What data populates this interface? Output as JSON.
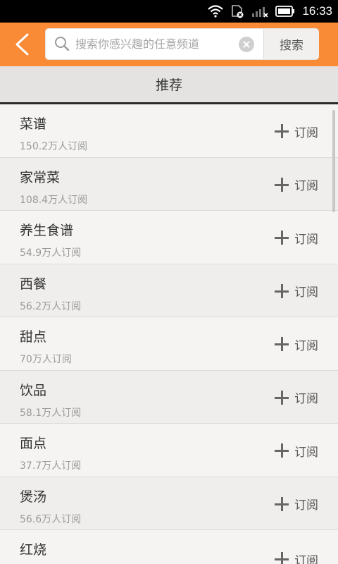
{
  "status_bar": {
    "time": "16:33"
  },
  "header": {
    "search_placeholder": "搜索你感兴趣的任意频道",
    "search_button": "搜索"
  },
  "section": {
    "title": "推荐"
  },
  "colors": {
    "accent": "#f98a36"
  },
  "items": [
    {
      "name": "菜谱",
      "count": "150.2万人订阅",
      "action": "订阅"
    },
    {
      "name": "家常菜",
      "count": "108.4万人订阅",
      "action": "订阅"
    },
    {
      "name": "养生食谱",
      "count": "54.9万人订阅",
      "action": "订阅"
    },
    {
      "name": "西餐",
      "count": "56.2万人订阅",
      "action": "订阅"
    },
    {
      "name": "甜点",
      "count": "70万人订阅",
      "action": "订阅"
    },
    {
      "name": "饮品",
      "count": "58.1万人订阅",
      "action": "订阅"
    },
    {
      "name": "面点",
      "count": "37.7万人订阅",
      "action": "订阅"
    },
    {
      "name": "煲汤",
      "count": "56.6万人订阅",
      "action": "订阅"
    },
    {
      "name": "红烧",
      "count": "",
      "action": "订阅"
    }
  ]
}
